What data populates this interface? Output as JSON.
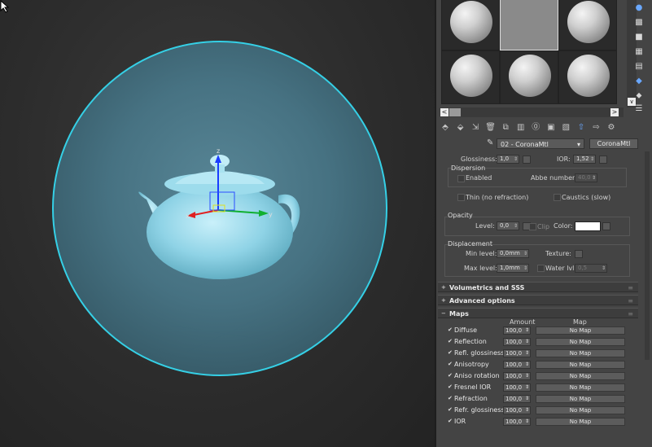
{
  "viewport": {
    "colors": {
      "selection_outline": "#35d0e6",
      "sphere_fill": "#4a7d90",
      "teapot": "#8fd3e6"
    },
    "gizmo_axes": {
      "x": "x",
      "y": "y",
      "z": "z"
    }
  },
  "slots": {
    "count": 6,
    "selected": 1,
    "scroll_left": "<",
    "scroll_right": ">",
    "scroll_down": "∨"
  },
  "side_tools": [
    "sphere-icon",
    "checker-icon",
    "background-icon",
    "sample-uv-icon",
    "video-color-icon",
    "options-icon",
    "pick-icon",
    "material-editor-options-icon",
    "list-icon"
  ],
  "toolbar_icons": [
    "get-material-icon",
    "put-material-icon",
    "assign-icon",
    "reset-icon",
    "delete-icon",
    "make-unique-icon",
    "put-library-icon",
    "material-id-icon",
    "show-map-icon",
    "show-end-result-icon",
    "go-parent-icon",
    "go-sibling-icon",
    "select-by-material-icon"
  ],
  "material": {
    "name": "02 - CoronaMtl",
    "type": "CoronaMtl"
  },
  "refraction": {
    "glossiness_label": "Glossiness:",
    "glossiness_value": "1,0",
    "ior_label": "IOR:",
    "ior_value": "1,52",
    "dispersion_label": "Dispersion",
    "enabled_label": "Enabled",
    "abbe_label": "Abbe number:",
    "abbe_value": "40,0",
    "thin_label": "Thin (no refraction)",
    "caustics_label": "Caustics (slow)"
  },
  "opacity": {
    "group_label": "Opacity",
    "level_label": "Level:",
    "level_value": "0,0",
    "clip_label": "Clip",
    "color_label": "Color:",
    "color_value": "#ffffff"
  },
  "displacement": {
    "group_label": "Displacement",
    "min_label": "Min level:",
    "min_value": "0,0mm",
    "texture_label": "Texture:",
    "max_label": "Max level:",
    "max_value": "1,0mm",
    "water_label": "Water lvl.:",
    "water_value": "0,5"
  },
  "rollouts": {
    "volumetrics": "Volumetrics and SSS",
    "advanced": "Advanced options",
    "maps": "Maps"
  },
  "maps": {
    "amount_header": "Amount",
    "map_header": "Map",
    "rows": [
      {
        "name": "Diffuse",
        "amount": "100,0",
        "map": "No Map"
      },
      {
        "name": "Reflection",
        "amount": "100,0",
        "map": "No Map"
      },
      {
        "name": "Refl. glossiness",
        "amount": "100,0",
        "map": "No Map"
      },
      {
        "name": "Anisotropy",
        "amount": "100,0",
        "map": "No Map"
      },
      {
        "name": "Aniso rotation",
        "amount": "100,0",
        "map": "No Map"
      },
      {
        "name": "Fresnel IOR",
        "amount": "100,0",
        "map": "No Map"
      },
      {
        "name": "Refraction",
        "amount": "100,0",
        "map": "No Map"
      },
      {
        "name": "Refr. glossiness",
        "amount": "100,0",
        "map": "No Map"
      },
      {
        "name": "IOR",
        "amount": "100,0",
        "map": "No Map"
      }
    ]
  }
}
